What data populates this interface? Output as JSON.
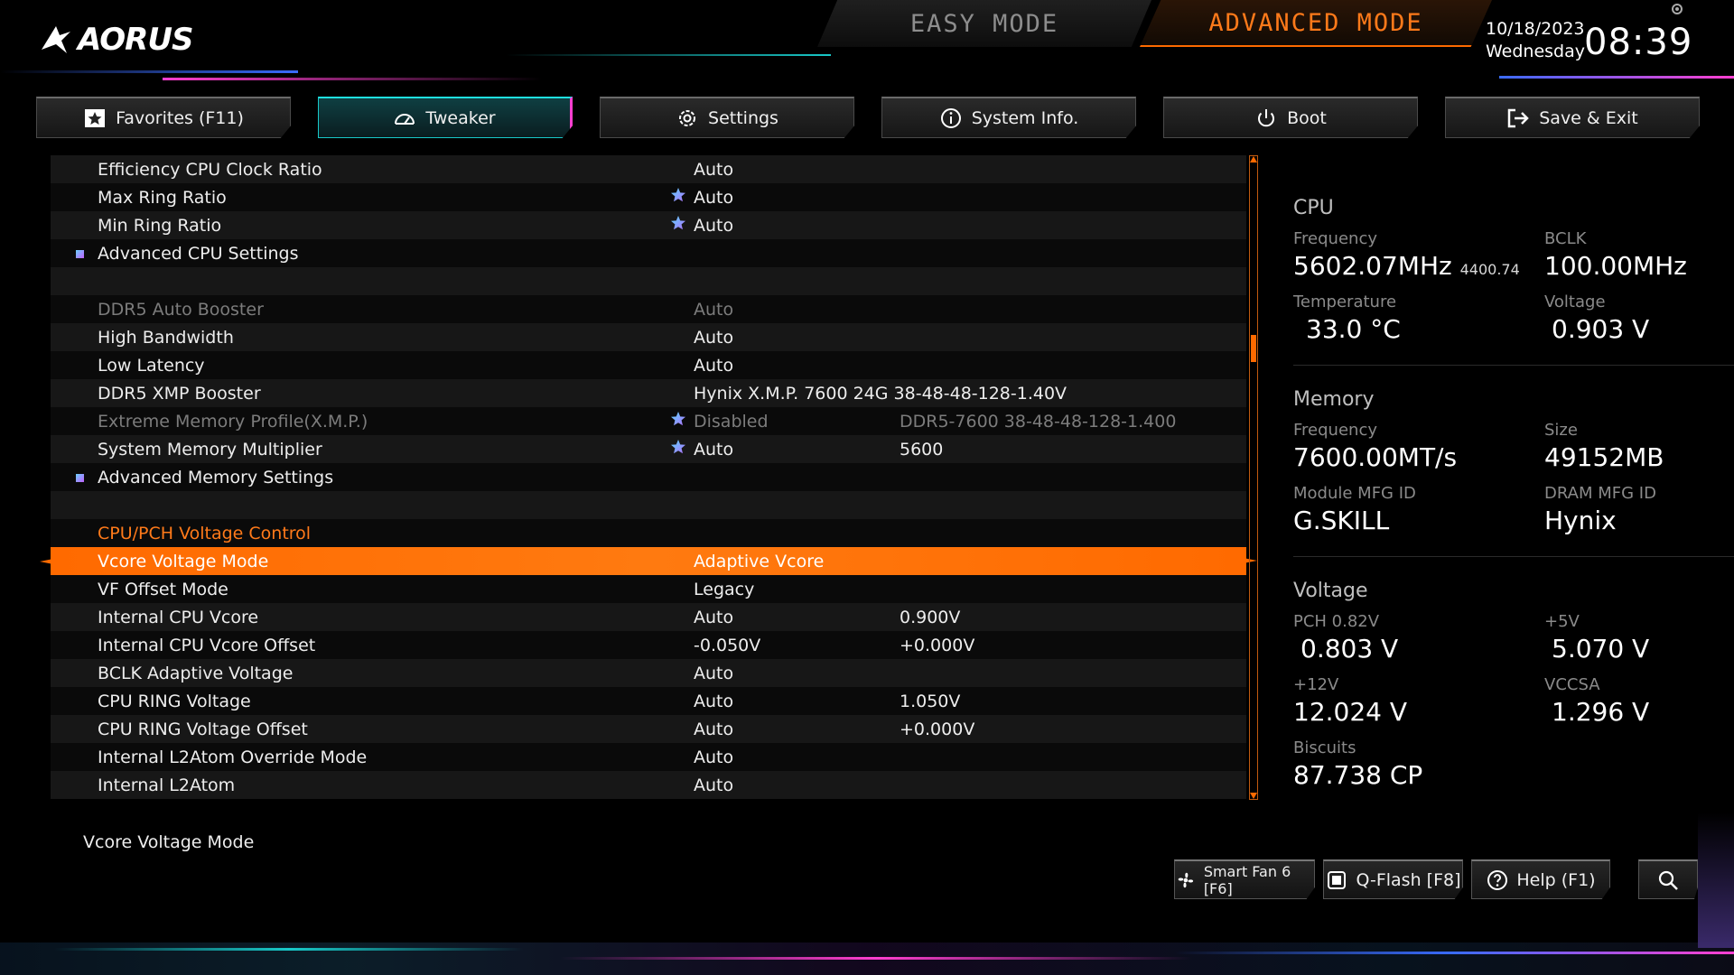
{
  "header": {
    "logo_text": "AORUS",
    "easy_mode": "EASY MODE",
    "advanced_mode": "ADVANCED MODE",
    "date": "10/18/2023",
    "weekday": "Wednesday",
    "time": "08:39"
  },
  "tabs": [
    {
      "label": "Favorites (F11)",
      "icon": "star-icon"
    },
    {
      "label": "Tweaker",
      "icon": "gauge-icon"
    },
    {
      "label": "Settings",
      "icon": "gear-icon"
    },
    {
      "label": "System Info.",
      "icon": "info-icon"
    },
    {
      "label": "Boot",
      "icon": "power-icon"
    },
    {
      "label": "Save & Exit",
      "icon": "exit-icon"
    }
  ],
  "settings": [
    {
      "name": "Efficiency CPU Clock Ratio",
      "v1": "Auto",
      "v2": ""
    },
    {
      "name": "Max Ring Ratio",
      "v1": "Auto",
      "v2": "",
      "star": true
    },
    {
      "name": "Min Ring Ratio",
      "v1": "Auto",
      "v2": "",
      "star": true
    },
    {
      "name": "Advanced CPU Settings",
      "v1": "",
      "v2": "",
      "submenu": true
    },
    {
      "name": "",
      "v1": "",
      "v2": ""
    },
    {
      "name": "DDR5 Auto Booster",
      "v1": "Auto",
      "v2": "",
      "dim": true
    },
    {
      "name": "High Bandwidth",
      "v1": "Auto",
      "v2": ""
    },
    {
      "name": "Low Latency",
      "v1": "Auto",
      "v2": ""
    },
    {
      "name": "DDR5 XMP Booster",
      "v1": "Hynix X.M.P. 7600 24G 38-48-48-128-1.40V",
      "v2": ""
    },
    {
      "name": "Extreme Memory Profile(X.M.P.)",
      "v1": "Disabled",
      "v2": "DDR5-7600 38-48-48-128-1.400",
      "star": true,
      "dim": true
    },
    {
      "name": "System Memory Multiplier",
      "v1": "Auto",
      "v2": "5600",
      "star": true
    },
    {
      "name": "Advanced Memory Settings",
      "v1": "",
      "v2": "",
      "submenu": true
    },
    {
      "name": "",
      "v1": "",
      "v2": ""
    },
    {
      "name": "CPU/PCH Voltage Control",
      "v1": "",
      "v2": "",
      "header": true
    },
    {
      "name": "Vcore Voltage Mode",
      "v1": "Adaptive Vcore",
      "v2": "",
      "selected": true
    },
    {
      "name": "VF Offset Mode",
      "v1": "Legacy",
      "v2": ""
    },
    {
      "name": "Internal CPU Vcore",
      "v1": "Auto",
      "v2": "0.900V"
    },
    {
      "name": "Internal CPU Vcore Offset",
      "v1": "-0.050V",
      "v2": "+0.000V"
    },
    {
      "name": "BCLK Adaptive Voltage",
      "v1": "Auto",
      "v2": ""
    },
    {
      "name": "CPU RING Voltage",
      "v1": "Auto",
      "v2": "1.050V"
    },
    {
      "name": "CPU RING Voltage Offset",
      "v1": "Auto",
      "v2": "+0.000V"
    },
    {
      "name": "Internal L2Atom Override Mode",
      "v1": "Auto",
      "v2": ""
    },
    {
      "name": "Internal L2Atom",
      "v1": "Auto",
      "v2": ""
    }
  ],
  "description": "Vcore Voltage Mode",
  "info": {
    "cpu": {
      "title": "CPU",
      "frequency_label": "Frequency",
      "frequency": "5602.07MHz",
      "frequency_sub": "4400.74",
      "bclk_label": "BCLK",
      "bclk": "100.00MHz",
      "temp_label": "Temperature",
      "temp": "33.0 °C",
      "voltage_label": "Voltage",
      "voltage": "0.903 V"
    },
    "memory": {
      "title": "Memory",
      "frequency_label": "Frequency",
      "frequency": "7600.00MT/s",
      "size_label": "Size",
      "size": "49152MB",
      "module_label": "Module MFG ID",
      "module": "G.SKILL",
      "dram_label": "DRAM MFG ID",
      "dram": "Hynix"
    },
    "voltage": {
      "title": "Voltage",
      "pch_label": "PCH 0.82V",
      "pch": "0.803 V",
      "v5_label": "+5V",
      "v5": "5.070 V",
      "v12_label": "+12V",
      "v12": "12.024 V",
      "vccsa_label": "VCCSA",
      "vccsa": "1.296 V",
      "biscuits_label": "Biscuits",
      "biscuits": "87.738 CP"
    }
  },
  "bottom_buttons": {
    "smartfan": "Smart Fan 6 [F6]",
    "qflash": "Q-Flash [F8]",
    "help": "Help (F1)"
  },
  "colors": {
    "accent": "#ff6a00",
    "active_tab": "#18c9c9",
    "header_text": "#ff7a1a"
  }
}
